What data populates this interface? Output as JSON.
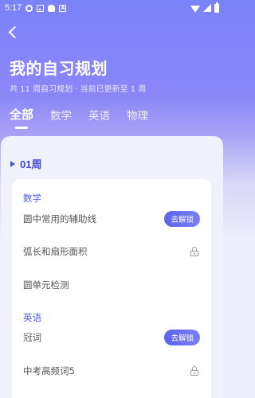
{
  "status_bar": {
    "time": "5:17",
    "left_icons": [
      "settings-icon",
      "image-icon",
      "ghost-icon",
      "a-icon"
    ],
    "right_icons": [
      "wifi-icon",
      "signal-icon",
      "battery-icon"
    ]
  },
  "header": {
    "back_icon": "chevron-left-icon",
    "title": "我的自习规划",
    "subtitle": "共 11 周自习规划 · 当前已更新至 1 周"
  },
  "tabs": [
    {
      "label": "全部",
      "active": true
    },
    {
      "label": "数学",
      "active": false
    },
    {
      "label": "英语",
      "active": false
    },
    {
      "label": "物理",
      "active": false
    }
  ],
  "week": {
    "label": "01周"
  },
  "sections": [
    {
      "subject": "数学",
      "items": [
        {
          "label": "圆中常用的辅助线",
          "action": "去解锁",
          "locked": false
        },
        {
          "label": "弧长和扇形面积",
          "locked": true
        },
        {
          "label": "圆单元检测",
          "locked": false
        }
      ]
    },
    {
      "subject": "英语",
      "items": [
        {
          "label": "冠词",
          "action": "去解锁",
          "locked": false
        },
        {
          "label": "中考高频词5",
          "locked": true
        }
      ]
    }
  ],
  "colors": {
    "accent": "#4a55e0",
    "header_gradient_start": "#7a83f7",
    "panel_bg": "#f0f1fa"
  }
}
